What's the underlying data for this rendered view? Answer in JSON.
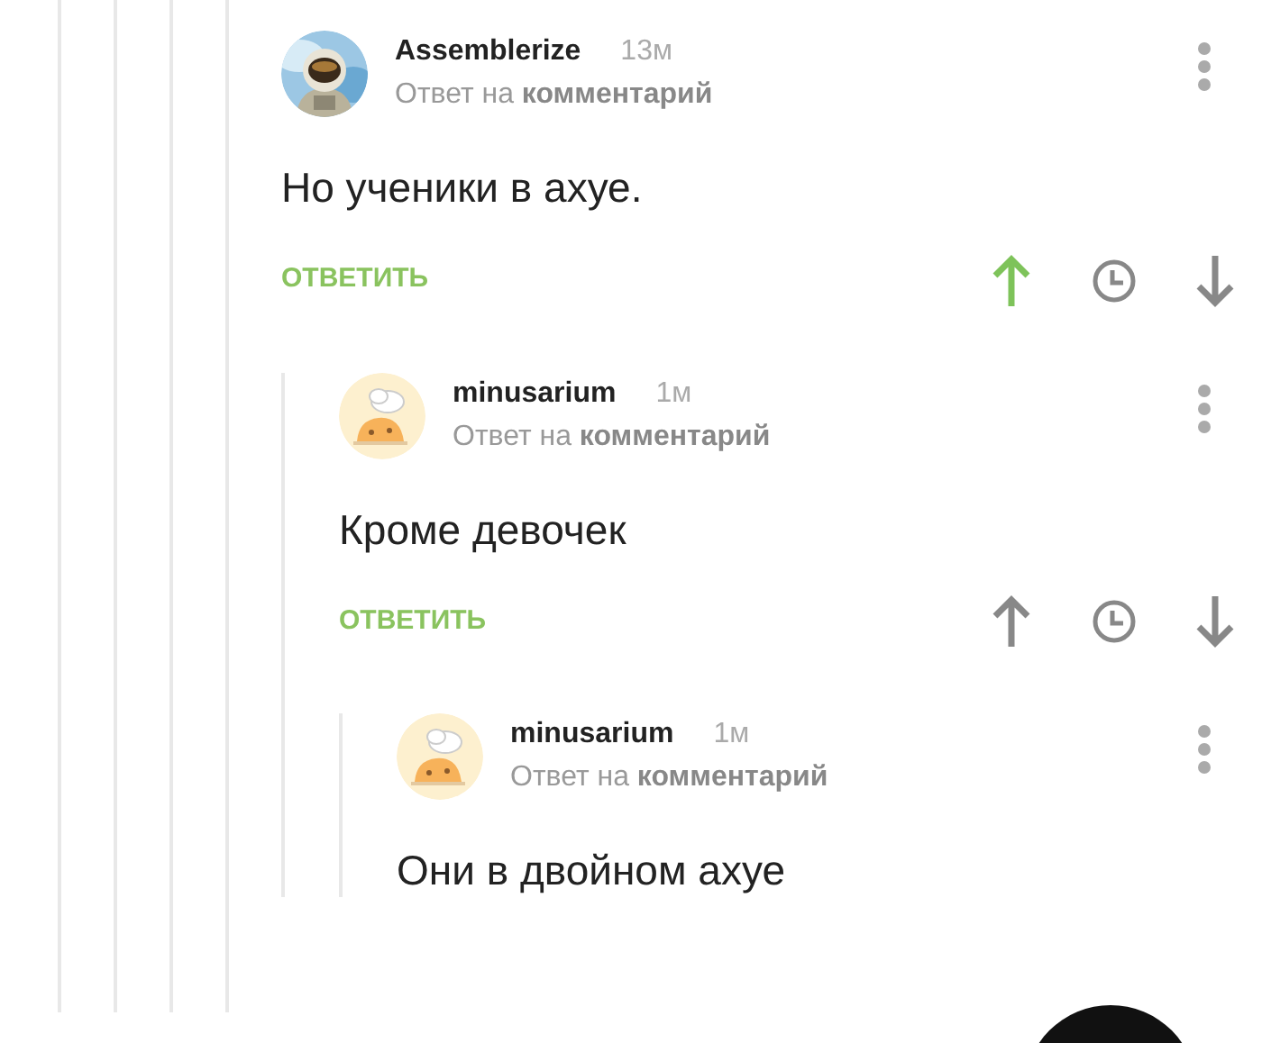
{
  "comments": [
    {
      "author": "Assemblerize",
      "time": "13м",
      "reply_to": "Ответ на **комментарий**",
      "text": "Но ученики в ахуе.",
      "reply_label": "ОТВЕТИТЬ",
      "upvoted": true,
      "children": [
        {
          "author": "minusarium",
          "time": "1м",
          "reply_to": "Ответ на **комментарий**",
          "avatar": {
            "kind": "cartoon"
          },
          "text": "Кроме девочек",
          "reply_label": "ОТВЕТИТЬ",
          "upvoted": false,
          "children": [
            {
              "author": "minusarium",
              "time": "1м",
              "reply_to": "Ответ на **комментарий**",
              "avatar": {
                "kind": "cartoon"
              },
              "text": "Они в двойном ахуе"
            }
          ]
        }
      ]
    }
  ]
}
